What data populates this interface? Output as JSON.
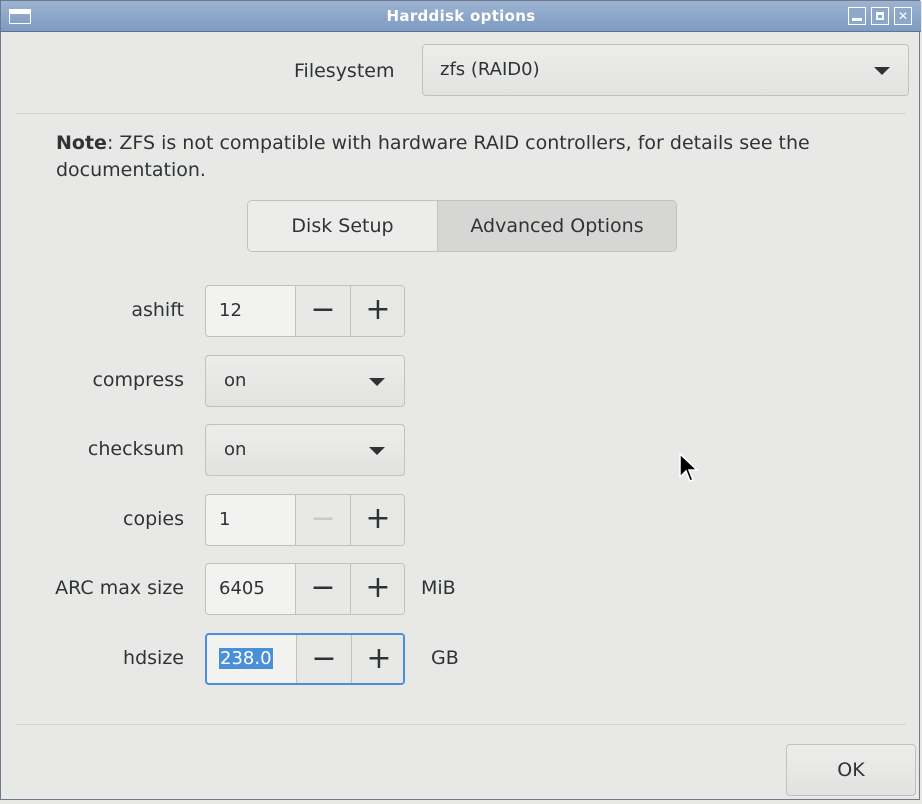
{
  "window": {
    "title": "Harddisk options"
  },
  "filesystem": {
    "label": "Filesystem",
    "value": "zfs (RAID0)"
  },
  "note": {
    "prefix": "Note",
    "text": ": ZFS is not compatible with hardware RAID controllers, for details see the documentation."
  },
  "tabs": [
    {
      "label": "Disk Setup",
      "active": false
    },
    {
      "label": "Advanced Options",
      "active": true
    }
  ],
  "options": {
    "ashift": {
      "label": "ashift",
      "value": "12"
    },
    "compress": {
      "label": "compress",
      "value": "on"
    },
    "checksum": {
      "label": "checksum",
      "value": "on"
    },
    "copies": {
      "label": "copies",
      "value": "1"
    },
    "arc_max": {
      "label": "ARC max size",
      "value": "6405",
      "unit": "MiB"
    },
    "hdsize": {
      "label": "hdsize",
      "value": "238.0",
      "unit": "GB"
    }
  },
  "buttons": {
    "minus": "−",
    "plus": "+",
    "ok": "OK"
  },
  "colors": {
    "titlebar": "#8ea8cb",
    "focus": "#4a90d9",
    "background": "#e8e8e7"
  }
}
